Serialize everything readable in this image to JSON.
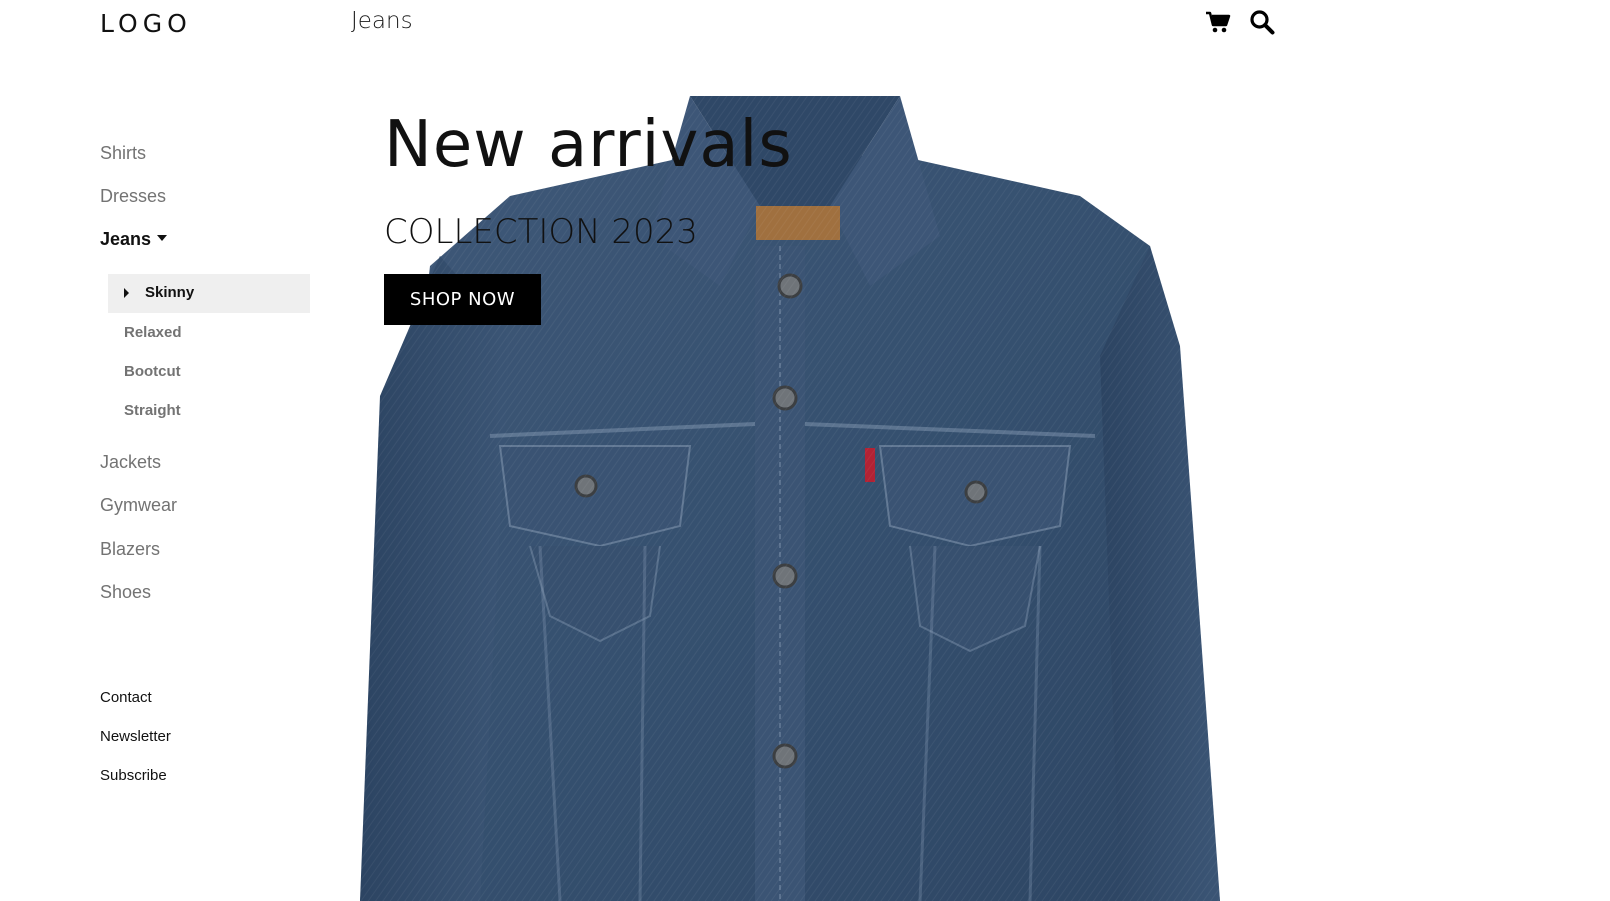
{
  "header": {
    "logo": "LOGO",
    "title": "Jeans",
    "icons": [
      "cart-icon",
      "search-icon"
    ]
  },
  "sidebar": {
    "categories": [
      {
        "label": "Shirts"
      },
      {
        "label": "Dresses"
      },
      {
        "label": "Jeans",
        "active": true
      },
      {
        "label": "Jackets"
      },
      {
        "label": "Gymwear"
      },
      {
        "label": "Blazers"
      },
      {
        "label": "Shoes"
      }
    ],
    "jeans_subcategories": [
      {
        "label": "Skinny",
        "selected": true
      },
      {
        "label": "Relaxed"
      },
      {
        "label": "Bootcut"
      },
      {
        "label": "Straight"
      }
    ],
    "footer_links": [
      {
        "label": "Contact"
      },
      {
        "label": "Newsletter"
      },
      {
        "label": "Subscribe"
      }
    ]
  },
  "hero": {
    "title": "New arrivals",
    "subtitle": "COLLECTION 2023",
    "button_label": "SHOP NOW",
    "image": "denim-jacket"
  },
  "colors": {
    "text_dark": "#111111",
    "text_muted": "#737373",
    "selected_bg": "#efefef",
    "button_bg": "#000000",
    "denim": "#3a5270"
  }
}
